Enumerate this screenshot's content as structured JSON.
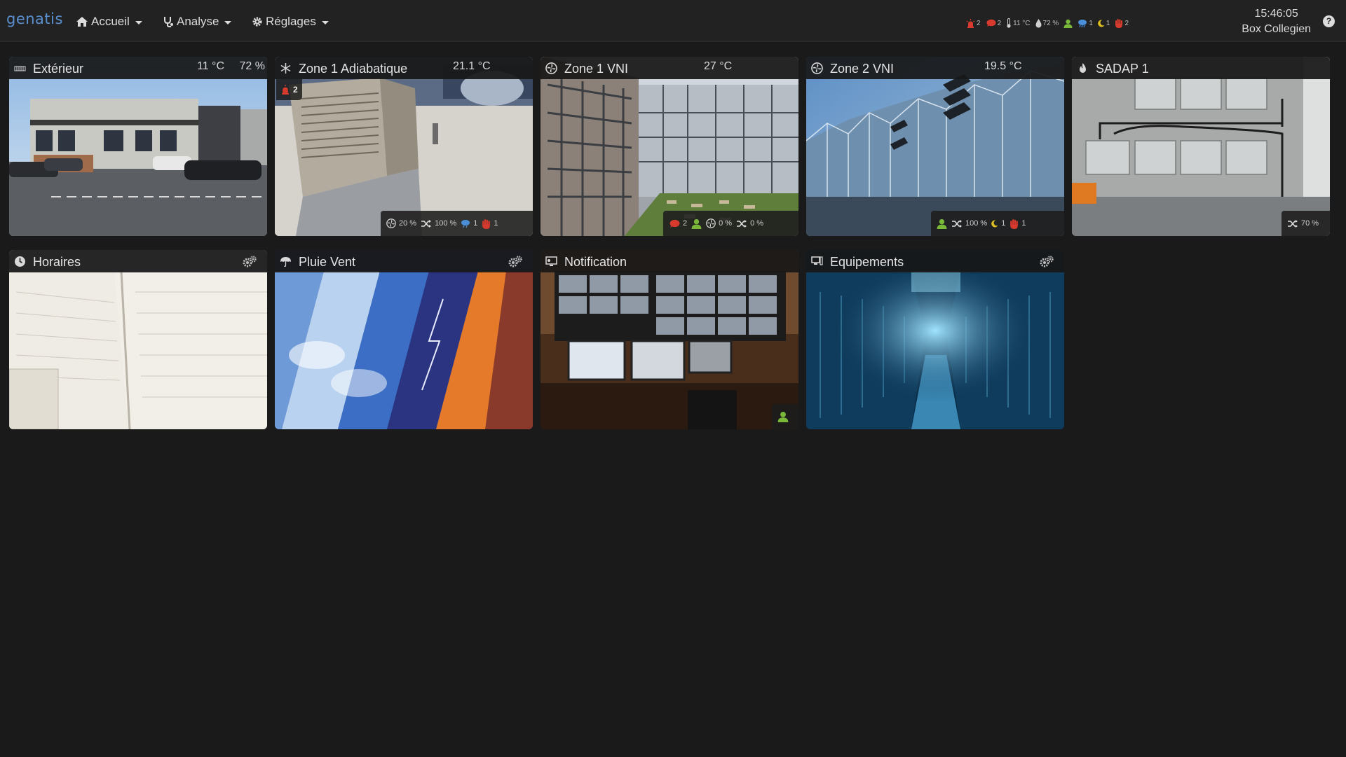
{
  "app": {
    "brand": "genatis",
    "brand_sub": ""
  },
  "nav": {
    "home_label": "Accueil",
    "analyse_label": "Analyse",
    "settings_label": "Réglages"
  },
  "status": {
    "alarm_count": "2",
    "comment_count": "2",
    "temperature": "11 °C",
    "humidity": "72 %",
    "rain_count": "1",
    "moon_count": "1",
    "stop_count": "2"
  },
  "clock": {
    "time": "15:46:05",
    "box_name": "Box Collegien"
  },
  "help": "?",
  "tiles": [
    {
      "title": "Extérieur",
      "temp": "11 °C",
      "humidity": "72 %"
    },
    {
      "title": "Zone 1 Adiabatique",
      "temp": "21.1 °C",
      "alarm": "2",
      "fan": "20 %",
      "mix": "100 %",
      "rain": "1",
      "stop": "1"
    },
    {
      "title": "Zone 1 VNI",
      "temp": "27 °C",
      "comment": "2",
      "fan": "0 %",
      "mix": "0 %"
    },
    {
      "title": "Zone 2 VNI",
      "temp": "19.5 °C",
      "mix": "100 %",
      "moon": "1",
      "stop": "1"
    },
    {
      "title": "SADAP 1",
      "mix": "70 %"
    },
    {
      "title": "Horaires"
    },
    {
      "title": "Pluie Vent"
    },
    {
      "title": "Notification"
    },
    {
      "title": "Equipements"
    }
  ],
  "colors": {
    "background": "#1a1a1a",
    "navbar": "#222222",
    "brand": "#5a8fd0",
    "alarm_red": "#d83a2e",
    "presence_green": "#7ab83a",
    "rain_blue": "#4a8fd8",
    "moon_yellow": "#e0c020"
  }
}
